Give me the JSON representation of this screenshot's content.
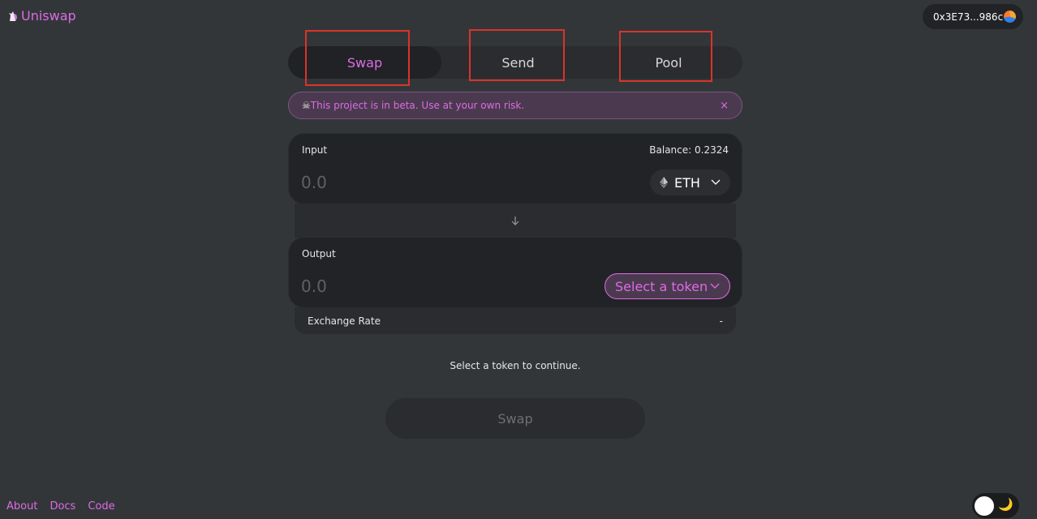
{
  "header": {
    "brand": "Uniswap",
    "wallet_address": "0x3E73...986c"
  },
  "tabs": [
    {
      "label": "Swap",
      "active": true
    },
    {
      "label": "Send",
      "active": false
    },
    {
      "label": "Pool",
      "active": false
    }
  ],
  "banner": {
    "icon": "skull-icon",
    "text": "This project is in beta. Use at your own risk.",
    "close": "×"
  },
  "input_panel": {
    "label": "Input",
    "balance": "Balance: 0.2324",
    "placeholder": "0.0",
    "token": "ETH"
  },
  "output_panel": {
    "label": "Output",
    "placeholder": "0.0",
    "token_button": "Select a token"
  },
  "exchange_rate": {
    "label": "Exchange Rate",
    "value": "-"
  },
  "hint": "Select a token to continue.",
  "swap_button": "Swap",
  "footer": {
    "links": [
      "About",
      "Docs",
      "Code"
    ]
  },
  "colors": {
    "accent": "#dc6be5",
    "background": "#333639",
    "panel": "#222326",
    "highlight_box": "#d9342b"
  }
}
